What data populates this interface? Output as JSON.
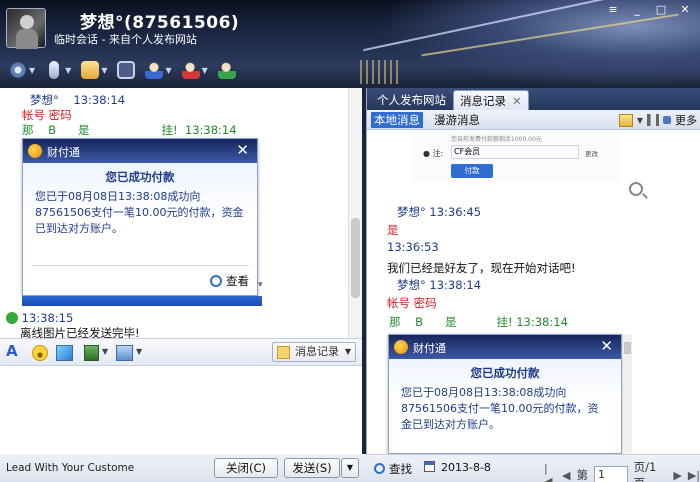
{
  "window": {
    "title": "梦想°(87561506)",
    "subtitle": "临时会话 - 来自个人发布网站",
    "controls": [
      "≡",
      "_",
      "□",
      "✕"
    ]
  },
  "left_chat": {
    "messages": [
      {
        "sender": "梦想°",
        "time": "13:38:14"
      },
      {
        "text": "帐号 密码"
      },
      {
        "text_a": "那",
        "text_b": "B",
        "text_c": "是",
        "text_d": "挂!",
        "time": "13:38:14"
      }
    ],
    "status_time": "13:38:15",
    "status_text": "离线图片已经发送完毕!"
  },
  "popup": {
    "app": "财付通",
    "heading": "您已成功付款",
    "body": "您已于08月08日13:38:08成功向87561506支付一笔10.00元的付款，资金已到达对方账户。",
    "link": "查看"
  },
  "input_toolbar": {
    "history_button": "消息记录"
  },
  "bottom_left": {
    "ad": "Lead With Your Custome",
    "close": "关闭(C)",
    "send": "发送(S)"
  },
  "right_panel": {
    "tabs": [
      {
        "label": "个人发布网站"
      },
      {
        "label": "消息记录"
      }
    ],
    "subtabs": [
      {
        "label": "本地消息"
      },
      {
        "label": "漫游消息"
      }
    ],
    "more": "更多",
    "pay_image": {
      "tiny": "您自前发费付款额剩余1000.00元",
      "label": "● 注:",
      "field": "CF会员",
      "change": "更改",
      "button": "付款"
    },
    "messages": [
      {
        "sender": "梦想°",
        "time": "13:36:45"
      },
      {
        "text": "是"
      },
      {
        "time": "13:36:53"
      },
      {
        "text": "我们已经是好友了，现在开始对话吧!"
      },
      {
        "sender": "梦想°",
        "time": "13:38:14"
      },
      {
        "text": "帐号 密码"
      },
      {
        "text_a": "那",
        "text_b": "B",
        "text_c": "是",
        "text_d": "挂!",
        "time": "13:38:14"
      }
    ],
    "bottom": {
      "search": "查找",
      "date": "2013-8-8",
      "page_label": "第",
      "page": "1",
      "page_total": "页/1页"
    }
  }
}
